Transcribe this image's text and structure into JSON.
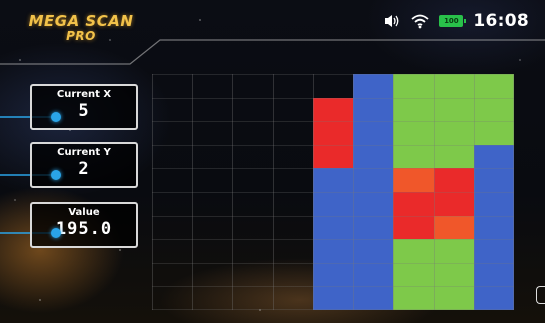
{
  "header": {
    "logo_line1": "MEGA SCAN",
    "logo_line2": "PRO",
    "clock": "16:08",
    "battery_level": "100",
    "icons": [
      "volume-icon",
      "wifi-icon",
      "battery-icon"
    ]
  },
  "readouts": {
    "current_x": {
      "label": "Current X",
      "value": "5"
    },
    "current_y": {
      "label": "Current Y",
      "value": "2"
    },
    "value": {
      "label": "Value",
      "value": "195.0"
    }
  },
  "colors": {
    "accent": "#2aa4e8",
    "logo": "#f2c24a",
    "blue": "#3f64c8",
    "green": "#7ec94a",
    "red": "#ea2a2a",
    "orange": "#f0572a",
    "empty": "#05070b"
  },
  "scan_grid": {
    "columns": 9,
    "rows": 10,
    "filled_from_column": 5,
    "cells": [
      [
        "E",
        "E",
        "E",
        "E",
        "E",
        "blue",
        "green",
        "green",
        "green"
      ],
      [
        "E",
        "E",
        "E",
        "E",
        "red",
        "blue",
        "green",
        "green",
        "green"
      ],
      [
        "E",
        "E",
        "E",
        "E",
        "red",
        "blue",
        "green",
        "green",
        "green"
      ],
      [
        "E",
        "E",
        "E",
        "E",
        "red",
        "blue",
        "green",
        "green",
        "blue"
      ],
      [
        "E",
        "E",
        "E",
        "E",
        "blue",
        "blue",
        "orange",
        "red",
        "blue"
      ],
      [
        "E",
        "E",
        "E",
        "E",
        "blue",
        "blue",
        "red",
        "red",
        "blue"
      ],
      [
        "E",
        "E",
        "E",
        "E",
        "blue",
        "blue",
        "red",
        "orange",
        "blue"
      ],
      [
        "E",
        "E",
        "E",
        "E",
        "blue",
        "blue",
        "green",
        "green",
        "blue"
      ],
      [
        "E",
        "E",
        "E",
        "E",
        "blue",
        "blue",
        "green",
        "green",
        "blue"
      ],
      [
        "E",
        "E",
        "E",
        "E",
        "blue",
        "blue",
        "green",
        "green",
        "blue"
      ]
    ]
  }
}
